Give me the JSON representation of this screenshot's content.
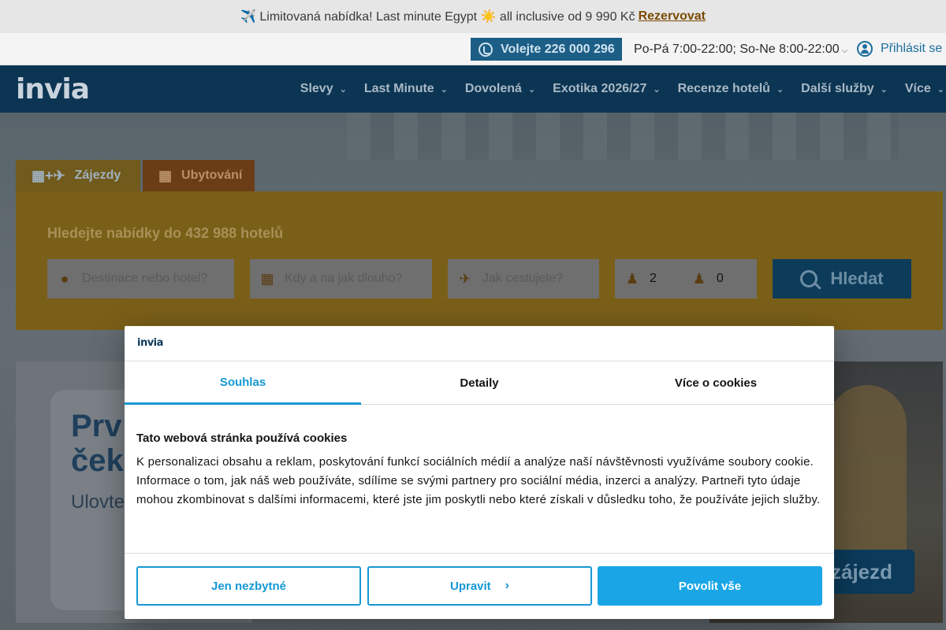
{
  "promo": {
    "text": "✈️ Limitovaná nabídka! Last minute Egypt ☀️ all inclusive od 9 990 Kč",
    "link": "Rezervovat"
  },
  "contact": {
    "phone": "Volejte 226 000 296",
    "hours": "Po-Pá 7:00-22:00; So-Ne 8:00-22:00",
    "login": "Přihlásit se"
  },
  "nav": {
    "logo": "invia",
    "items": [
      {
        "label": "Slevy"
      },
      {
        "label": "Last Minute"
      },
      {
        "label": "Dovolená"
      },
      {
        "label": "Exotika 2026/27"
      },
      {
        "label": "Recenze hotelů"
      },
      {
        "label": "Další služby"
      },
      {
        "label": "Více"
      }
    ]
  },
  "tabs": {
    "trips": "Zájezdy",
    "accommodation": "Ubytování"
  },
  "search": {
    "title": "Hledejte nabídky do 432 988 hotelů",
    "destination_placeholder": "Destinace nebo hotel?",
    "date_placeholder": "Kdy a na jak dlouho?",
    "transport_placeholder": "Jak cestujete?",
    "adults": "2",
    "children": "0",
    "button": "Hledat"
  },
  "banner": {
    "left_title_line1": "Prv",
    "left_title_line2": "ček",
    "left_subtitle": "Ulovte",
    "right_button": "zájezd"
  },
  "cookie_dialog": {
    "logo": "invia",
    "tabs": [
      "Souhlas",
      "Detaily",
      "Více o cookies"
    ],
    "active_tab": "Souhlas",
    "title": "Tato webová stránka používá cookies",
    "body": "K personalizaci obsahu a reklam, poskytování funkcí sociálních médií a analýze naší návštěvnosti využíváme soubory cookie. Informace o tom, jak náš web používáte, sdílíme se svými partnery pro sociální média, inzerci a analýzy. Partneři tyto údaje mohou zkombinovat s dalšími informacemi, které jste jim poskytli nebo které získali v důsledku toho, že používáte jejich služby.",
    "btn_necessary": "Jen nezbytné",
    "btn_customize": "Upravit",
    "btn_allow": "Povolit vše"
  },
  "colors": {
    "accent": "#1598d4",
    "nav_bg": "#0c3553",
    "search_bg": "#f2b705"
  }
}
